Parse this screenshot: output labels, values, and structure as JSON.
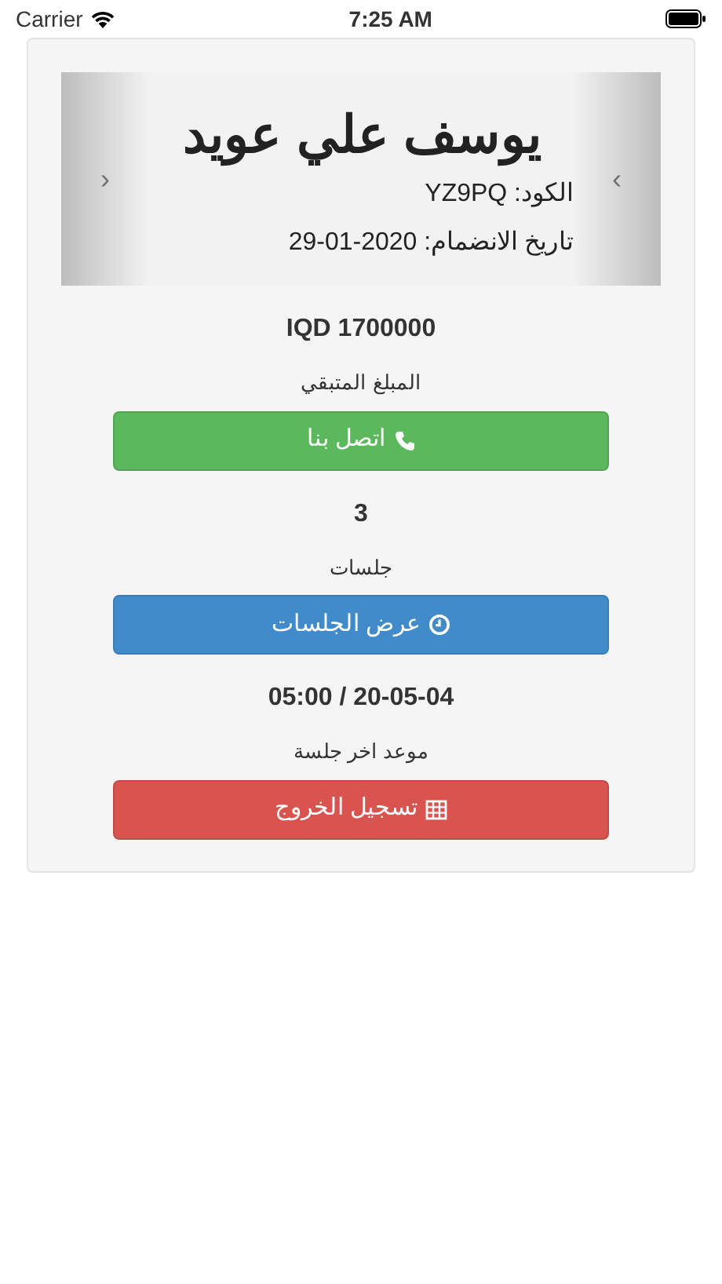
{
  "status_bar": {
    "carrier": "Carrier",
    "time": "7:25 AM"
  },
  "profile": {
    "name": "يوسف علي عويد",
    "code": "الكود: YZ9PQ",
    "joined": "تاريخ الانضمام: 2020-01-29",
    "prev_control": "›",
    "next_control": "‹"
  },
  "stats": [
    {
      "value": "IQD 1700000",
      "label": "المبلغ المتبقي",
      "button": {
        "text": "اتصل بنا",
        "kind": "phone",
        "color": "#5cb85c"
      }
    },
    {
      "value": "3",
      "label": "جلسات",
      "button": {
        "text": "عرض الجلسات",
        "kind": "clock",
        "color": "#428bca"
      }
    },
    {
      "value": "05:00 / 20-05-04",
      "label": "موعد اخر جلسة",
      "button": {
        "text": "تسجيل الخروج",
        "kind": "table",
        "color": "#d9534f"
      }
    }
  ]
}
